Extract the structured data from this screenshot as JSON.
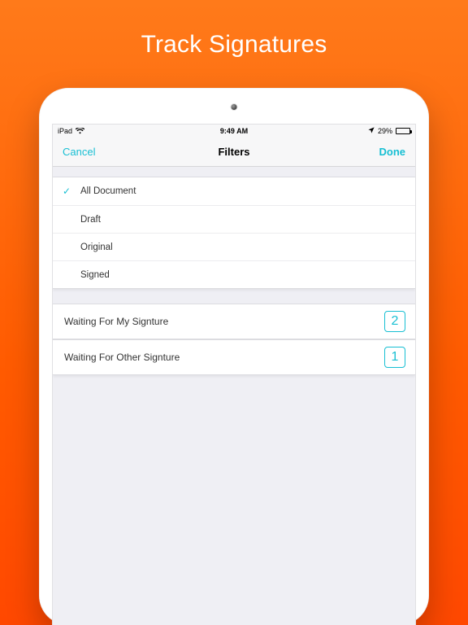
{
  "promo": {
    "title": "Track Signatures"
  },
  "statusbar": {
    "carrier": "iPad",
    "time": "9:49 AM",
    "battery_pct": "29%"
  },
  "navbar": {
    "cancel": "Cancel",
    "title": "Filters",
    "done": "Done"
  },
  "filters": {
    "items": [
      {
        "label": "All Document",
        "selected": true
      },
      {
        "label": "Draft",
        "selected": false
      },
      {
        "label": "Original",
        "selected": false
      },
      {
        "label": "Signed",
        "selected": false
      }
    ]
  },
  "summaries": [
    {
      "label": "Waiting For My Signture",
      "count": "2"
    },
    {
      "label": "Waiting For Other Signture",
      "count": "1"
    }
  ]
}
